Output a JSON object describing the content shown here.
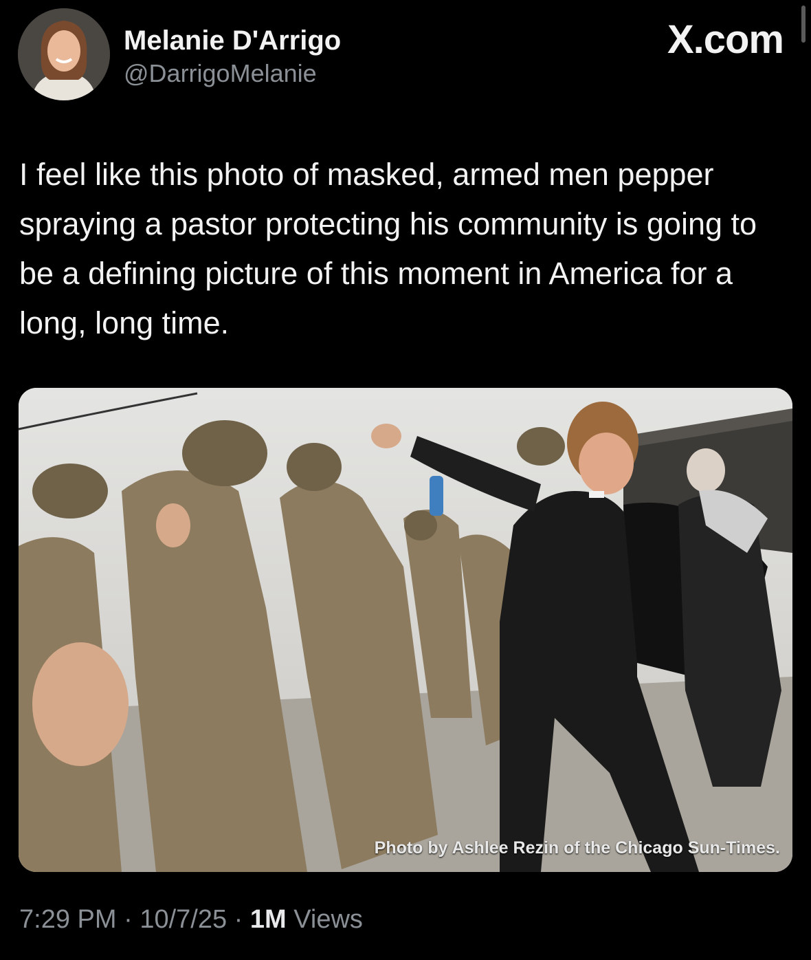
{
  "window": {
    "source_label": "X.com"
  },
  "author": {
    "display_name": "Melanie D'Arrigo",
    "handle": "@DarrigoMelanie"
  },
  "tweet": {
    "text": "I feel like this photo of masked, armed men pepper spraying a pastor protecting his community is going to be a defining picture of this moment in America for a long, long time.",
    "photo_credit": "Photo by Ashlee Rezin of the Chicago Sun-Times."
  },
  "meta": {
    "time": "7:29 PM",
    "separator": "·",
    "date": "10/7/25",
    "views_count": "1M",
    "views_label": "Views"
  },
  "colors": {
    "background": "#000000",
    "text_primary": "#e7e9ea",
    "text_secondary": "#8b9096"
  },
  "icons": {
    "brand": "x-logo-icon"
  }
}
